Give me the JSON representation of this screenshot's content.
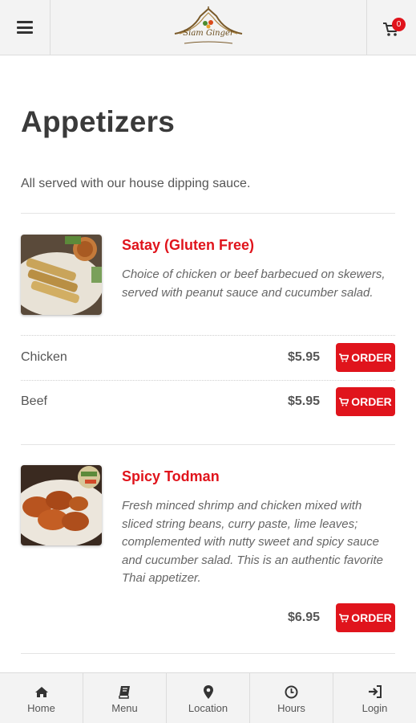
{
  "header": {
    "logo_text": "Siam Ginger",
    "cart_count": "0"
  },
  "page": {
    "title": "Appetizers",
    "subtitle": "All served with our house dipping sauce."
  },
  "items": [
    {
      "title": "Satay (Gluten Free)",
      "description": "Choice of chicken or beef barbecued on skewers, served with peanut sauce and cucumber salad.",
      "options": [
        {
          "label": "Chicken",
          "price": "$5.95",
          "button": "ORDER"
        },
        {
          "label": "Beef",
          "price": "$5.95",
          "button": "ORDER"
        }
      ]
    },
    {
      "title": "Spicy Todman",
      "description": "Fresh minced shrimp and chicken mixed with sliced string beans, curry paste, lime leaves; complemented with nutty sweet and spicy sauce and cucumber salad. This is an authentic favorite Thai appetizer.",
      "options": [
        {
          "label": "",
          "price": "$6.95",
          "button": "ORDER"
        }
      ]
    }
  ],
  "bottom_nav": [
    {
      "label": "Home",
      "icon": "home-icon"
    },
    {
      "label": "Menu",
      "icon": "book-icon"
    },
    {
      "label": "Location",
      "icon": "map-marker-icon"
    },
    {
      "label": "Hours",
      "icon": "clock-icon"
    },
    {
      "label": "Login",
      "icon": "sign-in-icon"
    }
  ],
  "colors": {
    "accent": "#e0141c",
    "bar_bg": "#f3f3f3",
    "text": "#3a3a3a"
  }
}
